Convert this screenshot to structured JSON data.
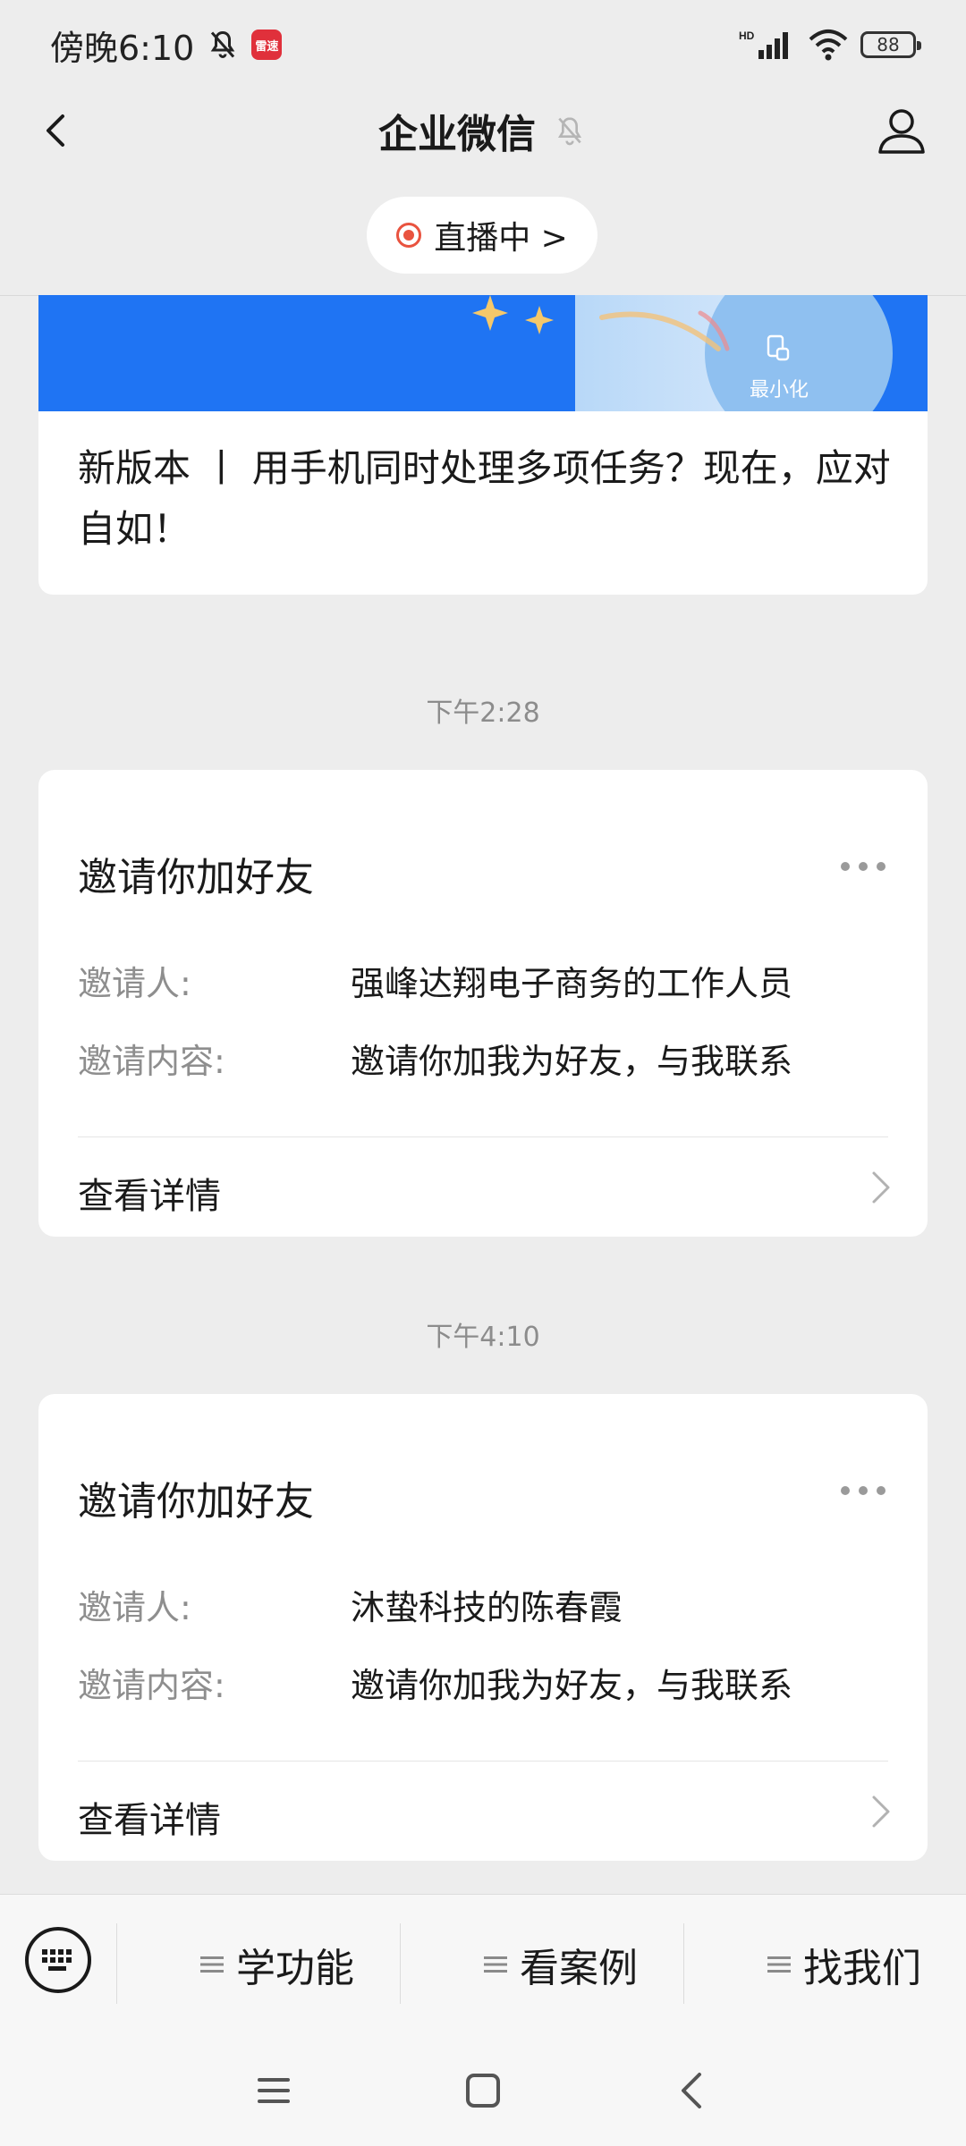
{
  "status_bar": {
    "time": "傍晚6:10",
    "app_badge": "雷速",
    "network": "HD",
    "battery": "88"
  },
  "nav": {
    "title": "企业微信"
  },
  "live": {
    "label": "直播中 >"
  },
  "article": {
    "banner_label": "最小化",
    "title": "新版本 丨 用手机同时处理多项任务？现在，应对自如！"
  },
  "messages": [
    {
      "time": "下午2:28",
      "title": "邀请你加好友",
      "inviter_label": "邀请人:",
      "inviter": "强峰达翔电子商务的工作人员",
      "content_label": "邀请内容:",
      "content": "邀请你加我为好友，与我联系",
      "detail": "查看详情"
    },
    {
      "time": "下午4:10",
      "title": "邀请你加好友",
      "inviter_label": "邀请人:",
      "inviter": "沐蛰科技的陈春霞",
      "content_label": "邀请内容:",
      "content": "邀请你加我为好友，与我联系",
      "detail": "查看详情"
    }
  ],
  "bottom_menu": {
    "items": [
      "学功能",
      "看案例",
      "找我们"
    ]
  },
  "colors": {
    "background": "#ededed",
    "card": "#ffffff",
    "banner_blue": "#1f74f3",
    "live_red": "#e9533f",
    "secondary_text": "#8e8e8e"
  }
}
